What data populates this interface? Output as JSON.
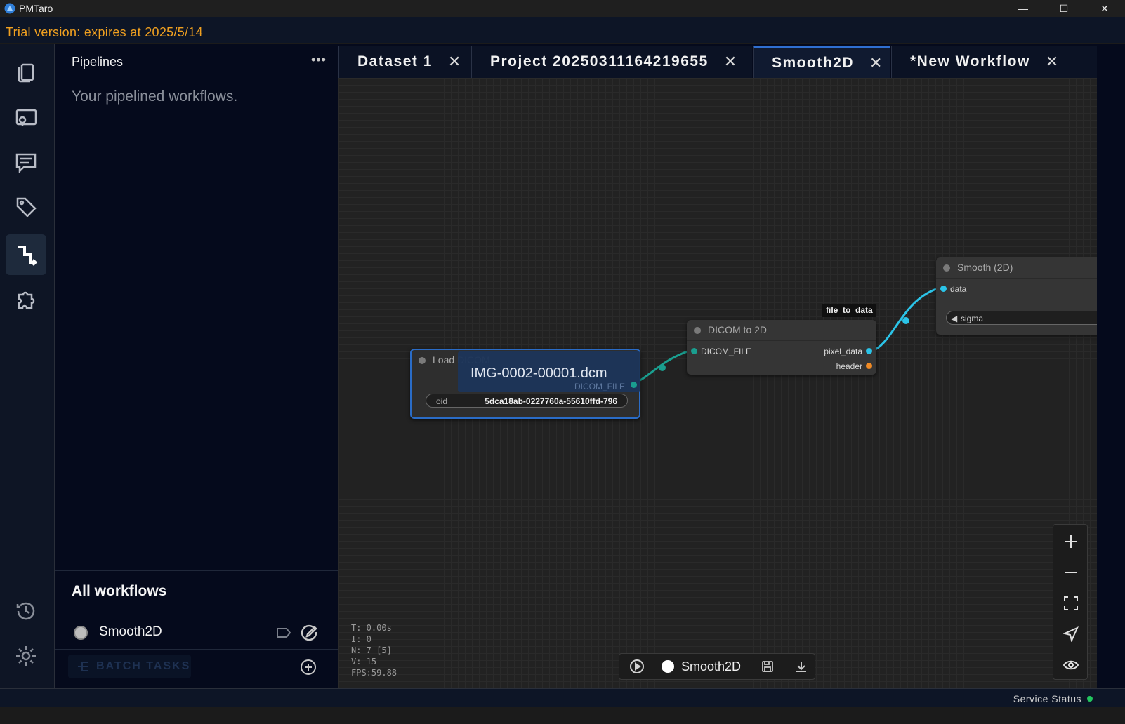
{
  "window": {
    "title": "PMTaro",
    "minimize": "—",
    "maximize": "☐",
    "close": "✕"
  },
  "trial": {
    "text": "Trial version: expires at 2025/5/14"
  },
  "rail": {
    "items": [
      "files-icon",
      "image-viewer-icon",
      "chat-icon",
      "tag-icon",
      "pipeline-icon",
      "plugin-icon",
      "history-icon",
      "settings-icon"
    ],
    "active": "pipeline-icon"
  },
  "panel": {
    "title": "Pipelines",
    "more": "•••",
    "description": "Your pipelined workflows.",
    "all_workflows": "All workflows",
    "workflows": [
      {
        "name": "Smooth2D"
      }
    ],
    "batch_tasks": "BATCH TASKS"
  },
  "tabs": [
    {
      "label": "Dataset 1",
      "close": "✕"
    },
    {
      "label": "Project 20250311164219655",
      "close": "✕"
    },
    {
      "label": "Smooth2D",
      "close": "✕",
      "active": true
    },
    {
      "label": "*New Workflow",
      "close": "✕"
    }
  ],
  "nodes": {
    "load": {
      "title": "Load DICOM",
      "filename": "IMG-0002-00001.dcm",
      "output": "DICOM_FILE",
      "widget_label": "oid",
      "widget_value": "5dca18ab-0227760a-55610ffd-796"
    },
    "dicom2d": {
      "title": "DICOM to 2D",
      "input": "DICOM_FILE",
      "outputs": [
        "pixel_data",
        "header"
      ]
    },
    "smooth": {
      "title": "Smooth (2D)",
      "input": "data",
      "widget_label": "sigma"
    },
    "link_label": "file_to_data"
  },
  "stats": {
    "t": "T: 0.00s",
    "i": "I: 0",
    "n": "N: 7 [5]",
    "v": "V: 15",
    "fps": "FPS:59.88"
  },
  "bottombar": {
    "workflow_name": "Smooth2D"
  },
  "status": {
    "text": "Service Status",
    "color": "#22c55e"
  },
  "colors": {
    "accent": "#2f6fd1",
    "trial": "#f0a020",
    "link_teal": "#1a9e8f",
    "link_cyan": "#2bc4e8"
  }
}
